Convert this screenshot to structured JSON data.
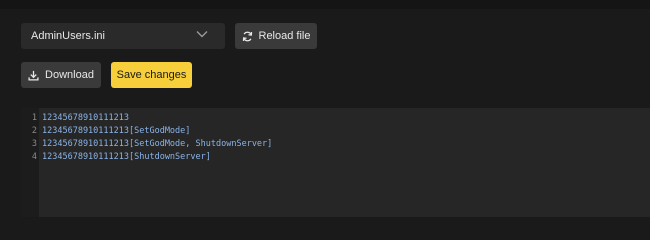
{
  "file_select": {
    "value": "AdminUsers.ini",
    "icon": "chevron-down-icon"
  },
  "toolbar": {
    "reload_label": "Reload file",
    "reload_icon": "refresh-icon",
    "download_label": "Download",
    "download_icon": "download-icon",
    "save_label": "Save changes"
  },
  "editor": {
    "lines": [
      {
        "number": "1",
        "text": "12345678910111213"
      },
      {
        "number": "2",
        "text": "12345678910111213[SetGodMode]"
      },
      {
        "number": "3",
        "text": "12345678910111213[SetGodMode, ShutdownServer]"
      },
      {
        "number": "4",
        "text": "12345678910111213[ShutdownServer]"
      }
    ]
  },
  "colors": {
    "background": "#1a1a1a",
    "button": "#3a3a3a",
    "accent": "#f7cf3b",
    "code_text": "#8ab4e8"
  }
}
